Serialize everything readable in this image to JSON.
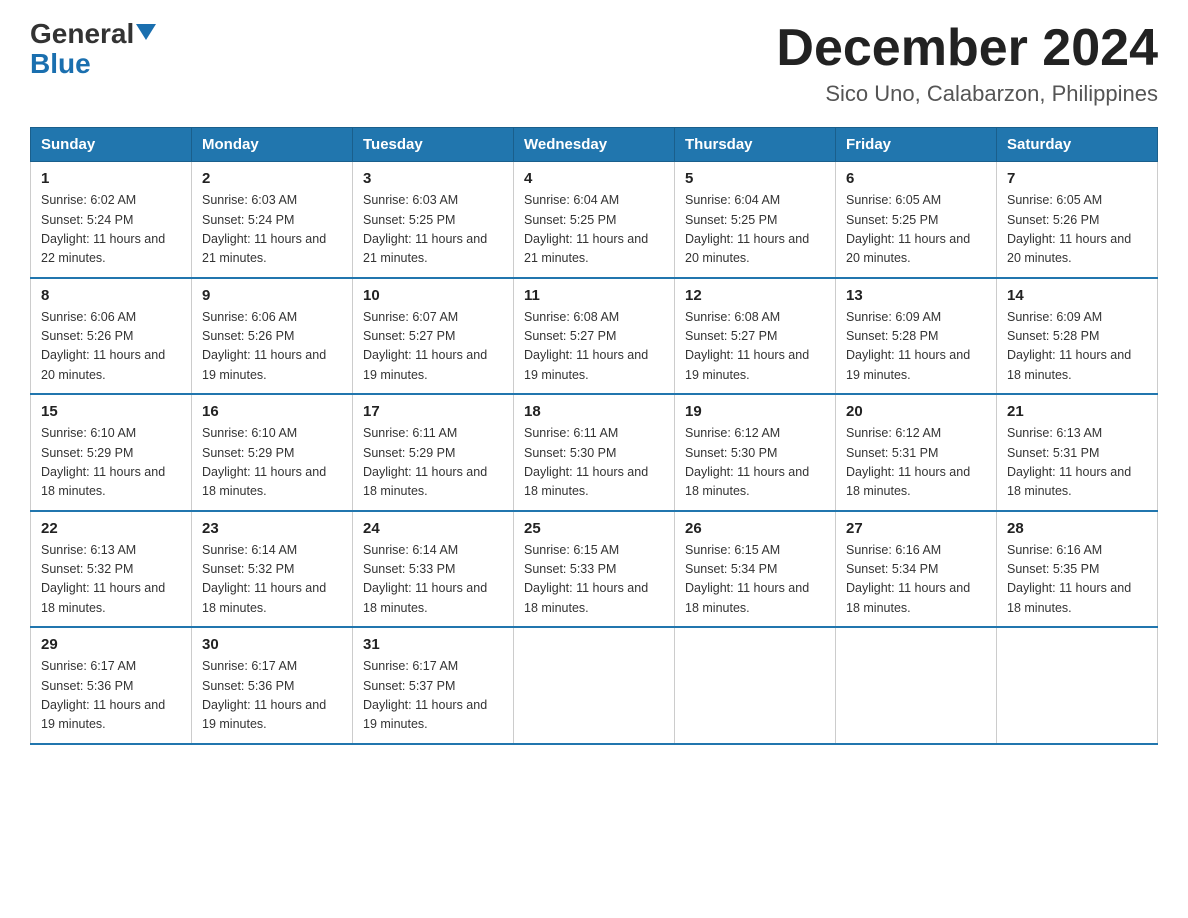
{
  "header": {
    "logo_general": "General",
    "logo_blue": "Blue",
    "month_title": "December 2024",
    "location": "Sico Uno, Calabarzon, Philippines"
  },
  "days_of_week": [
    "Sunday",
    "Monday",
    "Tuesday",
    "Wednesday",
    "Thursday",
    "Friday",
    "Saturday"
  ],
  "weeks": [
    [
      {
        "day": "1",
        "sunrise": "6:02 AM",
        "sunset": "5:24 PM",
        "daylight": "11 hours and 22 minutes."
      },
      {
        "day": "2",
        "sunrise": "6:03 AM",
        "sunset": "5:24 PM",
        "daylight": "11 hours and 21 minutes."
      },
      {
        "day": "3",
        "sunrise": "6:03 AM",
        "sunset": "5:25 PM",
        "daylight": "11 hours and 21 minutes."
      },
      {
        "day": "4",
        "sunrise": "6:04 AM",
        "sunset": "5:25 PM",
        "daylight": "11 hours and 21 minutes."
      },
      {
        "day": "5",
        "sunrise": "6:04 AM",
        "sunset": "5:25 PM",
        "daylight": "11 hours and 20 minutes."
      },
      {
        "day": "6",
        "sunrise": "6:05 AM",
        "sunset": "5:25 PM",
        "daylight": "11 hours and 20 minutes."
      },
      {
        "day": "7",
        "sunrise": "6:05 AM",
        "sunset": "5:26 PM",
        "daylight": "11 hours and 20 minutes."
      }
    ],
    [
      {
        "day": "8",
        "sunrise": "6:06 AM",
        "sunset": "5:26 PM",
        "daylight": "11 hours and 20 minutes."
      },
      {
        "day": "9",
        "sunrise": "6:06 AM",
        "sunset": "5:26 PM",
        "daylight": "11 hours and 19 minutes."
      },
      {
        "day": "10",
        "sunrise": "6:07 AM",
        "sunset": "5:27 PM",
        "daylight": "11 hours and 19 minutes."
      },
      {
        "day": "11",
        "sunrise": "6:08 AM",
        "sunset": "5:27 PM",
        "daylight": "11 hours and 19 minutes."
      },
      {
        "day": "12",
        "sunrise": "6:08 AM",
        "sunset": "5:27 PM",
        "daylight": "11 hours and 19 minutes."
      },
      {
        "day": "13",
        "sunrise": "6:09 AM",
        "sunset": "5:28 PM",
        "daylight": "11 hours and 19 minutes."
      },
      {
        "day": "14",
        "sunrise": "6:09 AM",
        "sunset": "5:28 PM",
        "daylight": "11 hours and 18 minutes."
      }
    ],
    [
      {
        "day": "15",
        "sunrise": "6:10 AM",
        "sunset": "5:29 PM",
        "daylight": "11 hours and 18 minutes."
      },
      {
        "day": "16",
        "sunrise": "6:10 AM",
        "sunset": "5:29 PM",
        "daylight": "11 hours and 18 minutes."
      },
      {
        "day": "17",
        "sunrise": "6:11 AM",
        "sunset": "5:29 PM",
        "daylight": "11 hours and 18 minutes."
      },
      {
        "day": "18",
        "sunrise": "6:11 AM",
        "sunset": "5:30 PM",
        "daylight": "11 hours and 18 minutes."
      },
      {
        "day": "19",
        "sunrise": "6:12 AM",
        "sunset": "5:30 PM",
        "daylight": "11 hours and 18 minutes."
      },
      {
        "day": "20",
        "sunrise": "6:12 AM",
        "sunset": "5:31 PM",
        "daylight": "11 hours and 18 minutes."
      },
      {
        "day": "21",
        "sunrise": "6:13 AM",
        "sunset": "5:31 PM",
        "daylight": "11 hours and 18 minutes."
      }
    ],
    [
      {
        "day": "22",
        "sunrise": "6:13 AM",
        "sunset": "5:32 PM",
        "daylight": "11 hours and 18 minutes."
      },
      {
        "day": "23",
        "sunrise": "6:14 AM",
        "sunset": "5:32 PM",
        "daylight": "11 hours and 18 minutes."
      },
      {
        "day": "24",
        "sunrise": "6:14 AM",
        "sunset": "5:33 PM",
        "daylight": "11 hours and 18 minutes."
      },
      {
        "day": "25",
        "sunrise": "6:15 AM",
        "sunset": "5:33 PM",
        "daylight": "11 hours and 18 minutes."
      },
      {
        "day": "26",
        "sunrise": "6:15 AM",
        "sunset": "5:34 PM",
        "daylight": "11 hours and 18 minutes."
      },
      {
        "day": "27",
        "sunrise": "6:16 AM",
        "sunset": "5:34 PM",
        "daylight": "11 hours and 18 minutes."
      },
      {
        "day": "28",
        "sunrise": "6:16 AM",
        "sunset": "5:35 PM",
        "daylight": "11 hours and 18 minutes."
      }
    ],
    [
      {
        "day": "29",
        "sunrise": "6:17 AM",
        "sunset": "5:36 PM",
        "daylight": "11 hours and 19 minutes."
      },
      {
        "day": "30",
        "sunrise": "6:17 AM",
        "sunset": "5:36 PM",
        "daylight": "11 hours and 19 minutes."
      },
      {
        "day": "31",
        "sunrise": "6:17 AM",
        "sunset": "5:37 PM",
        "daylight": "11 hours and 19 minutes."
      },
      null,
      null,
      null,
      null
    ]
  ]
}
